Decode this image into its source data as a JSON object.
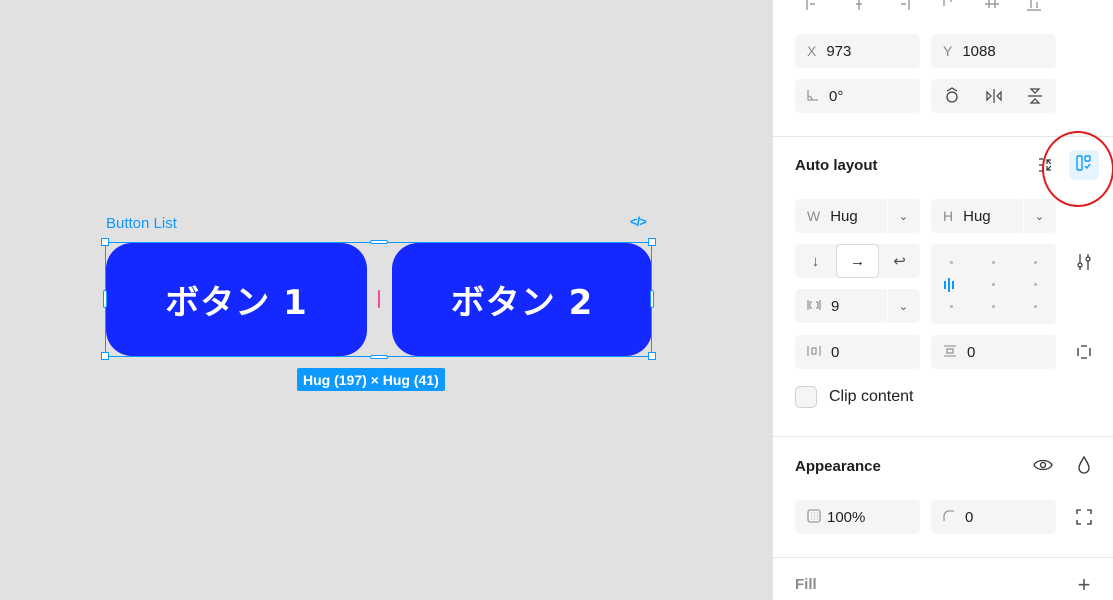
{
  "canvas": {
    "frame_label": "Button List",
    "code_icon": "</>",
    "buttons": [
      "ボタン 1",
      "ボタン 2"
    ],
    "size_badge": "Hug (197) × Hug (41)"
  },
  "panel": {
    "position": {
      "x_label": "X",
      "x_value": "973",
      "y_label": "Y",
      "y_value": "1088"
    },
    "rotation": {
      "value": "0°"
    },
    "auto_layout": {
      "title": "Auto layout",
      "width_label": "W",
      "width_value": "Hug",
      "height_label": "H",
      "height_value": "Hug",
      "gap_value": "9",
      "padding_h_value": "0",
      "padding_v_value": "0"
    },
    "clip_content": {
      "label": "Clip content",
      "checked": false
    },
    "appearance": {
      "title": "Appearance",
      "opacity_value": "100%",
      "radius_value": "0"
    },
    "fill": {
      "title": "Fill"
    }
  },
  "colors": {
    "accent": "#0d99ff",
    "button_fill": "#1428ff",
    "highlight": "#e01b1b"
  }
}
